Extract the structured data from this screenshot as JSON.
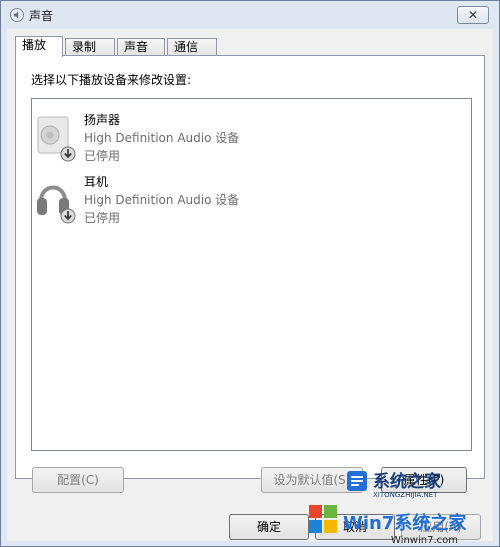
{
  "window": {
    "title": "声音",
    "close_symbol": "✕"
  },
  "tabs": [
    {
      "label": "播放",
      "active": true
    },
    {
      "label": "录制",
      "active": false
    },
    {
      "label": "声音",
      "active": false
    },
    {
      "label": "通信",
      "active": false
    }
  ],
  "playback": {
    "instruction": "选择以下播放设备来修改设置:",
    "devices": [
      {
        "name": "扬声器",
        "description": "High Definition Audio 设备",
        "status": "已停用",
        "icon": "speaker-icon"
      },
      {
        "name": "耳机",
        "description": "High Definition Audio 设备",
        "status": "已停用",
        "icon": "headphones-icon"
      }
    ]
  },
  "buttons": {
    "configure": "配置(C)",
    "set_default": "设为默认值(S)",
    "properties": "属性(P)",
    "ok": "确定",
    "cancel": "取消",
    "apply": "应用(A)"
  },
  "watermark": {
    "site_cn": "系统之家",
    "site_en": "XITONGZHIJIA.NET",
    "brand_cn": "Win7系统之家",
    "brand_en": "Winwin7.com"
  },
  "colors": {
    "frame": "#dfe7f2",
    "client": "#f0f0f0",
    "watermark_blue": "#1f6fd6"
  }
}
